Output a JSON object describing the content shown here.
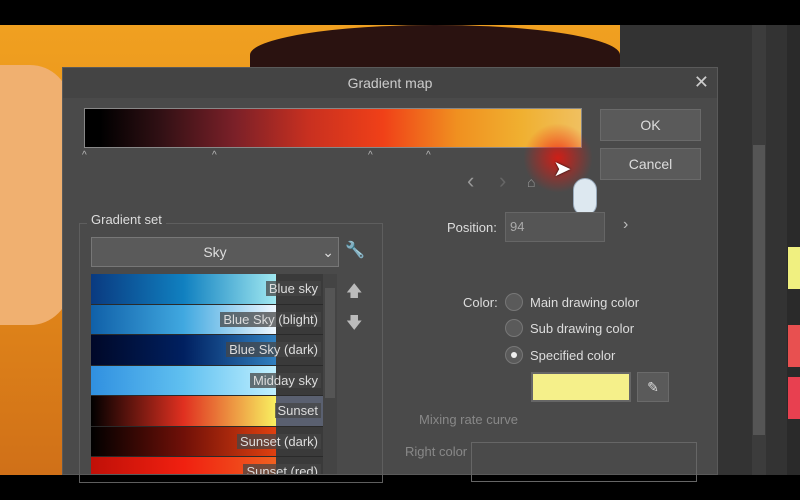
{
  "dialog": {
    "title": "Gradient map",
    "ok_label": "OK",
    "cancel_label": "Cancel"
  },
  "position": {
    "label": "Position:",
    "value": "94"
  },
  "gradient_set": {
    "label": "Gradient set",
    "selected": "Sky",
    "items": [
      {
        "name": "Blue sky",
        "colors": [
          "#0a3a80",
          "#1080c0",
          "#a0e8f0"
        ]
      },
      {
        "name": "Blue Sky (blight)",
        "colors": [
          "#1060a8",
          "#40a8e0",
          "#f0f8ff"
        ]
      },
      {
        "name": "Blue Sky (dark)",
        "colors": [
          "#000828",
          "#002060",
          "#3080c0"
        ]
      },
      {
        "name": "Midday sky",
        "colors": [
          "#3090e0",
          "#60c0f0",
          "#c0f0ff"
        ]
      },
      {
        "name": "Sunset",
        "colors": [
          "#000",
          "#e03020",
          "#f8f060"
        ]
      },
      {
        "name": "Sunset (dark)",
        "colors": [
          "#000",
          "#701008",
          "#e04010"
        ]
      },
      {
        "name": "Sunset (red)",
        "colors": [
          "#c01008",
          "#f02010",
          "#f06020"
        ]
      }
    ],
    "selected_index": 4
  },
  "color": {
    "label": "Color:",
    "options": [
      "Main drawing color",
      "Sub drawing color",
      "Specified color"
    ],
    "selected": "Specified color",
    "specified_hex": "#f5f08a"
  },
  "mixing_rate_curve": "Mixing rate curve",
  "right_color": "Right color"
}
